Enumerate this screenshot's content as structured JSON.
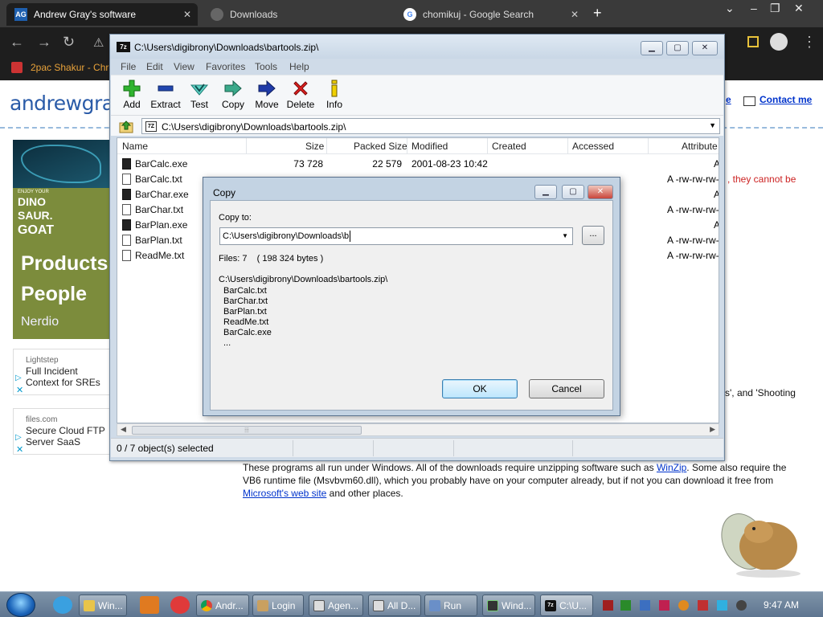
{
  "browser": {
    "tabs": [
      {
        "label": "Andrew Gray's software",
        "favicon": "AG"
      },
      {
        "label": "Downloads"
      },
      {
        "label": "chomikuj - Google Search"
      }
    ],
    "bookmark": "2pac Shakur - Chro"
  },
  "site": {
    "logo": "andrewgray",
    "e_link": "e",
    "contact": "Contact me",
    "ad1": {
      "small": "ENJOY YOUR",
      "line1": "DINO",
      "line2": "SAUR.",
      "line3": "GOAT",
      "products": "Products",
      "people": "People",
      "brand": "Nerdio"
    },
    "ad2": {
      "brand": "Lightstep",
      "title": "Full Incident Context for SREs"
    },
    "ad3": {
      "brand": "files.com",
      "title": "Secure Cloud FTP Server SaaS"
    },
    "red_text": ", they cannot be",
    "shooting_text": "s', and 'Shooting",
    "para_1": "These programs all run under Windows. All of the downloads require unzipping software such as ",
    "link_winzip": "WinZip",
    "para_2": ". Some also require the VB6 runtime file (Msvbvm60.dll), which you probably have on your computer already, but if not you can download it free from ",
    "link_ms": "Microsoft's web site",
    "para_3": " and other places."
  },
  "sevenzip": {
    "title": "C:\\Users\\digibrony\\Downloads\\bartools.zip\\",
    "menu": [
      "File",
      "Edit",
      "View",
      "Favorites",
      "Tools",
      "Help"
    ],
    "toolbar": [
      "Add",
      "Extract",
      "Test",
      "Copy",
      "Move",
      "Delete",
      "Info"
    ],
    "path": "C:\\Users\\digibrony\\Downloads\\bartools.zip\\",
    "columns": [
      "Name",
      "Size",
      "Packed Size",
      "Modified",
      "Created",
      "Accessed",
      "Attribute"
    ],
    "files": [
      {
        "name": "BarCalc.exe",
        "size": "73 728",
        "packed": "22 579",
        "modified": "2001-08-23 10:42",
        "attr": "A",
        "type": "exe"
      },
      {
        "name": "BarCalc.txt",
        "size": "",
        "packed": "",
        "modified": "",
        "attr": "A -rw-rw-rw-",
        "type": "txt"
      },
      {
        "name": "BarChar.exe",
        "size": "",
        "packed": "",
        "modified": "",
        "attr": "A",
        "type": "exe"
      },
      {
        "name": "BarChar.txt",
        "size": "",
        "packed": "",
        "modified": "",
        "attr": "A -rw-rw-rw-",
        "type": "txt"
      },
      {
        "name": "BarPlan.exe",
        "size": "",
        "packed": "",
        "modified": "",
        "attr": "A",
        "type": "exe"
      },
      {
        "name": "BarPlan.txt",
        "size": "",
        "packed": "",
        "modified": "",
        "attr": "A -rw-rw-rw-",
        "type": "txt"
      },
      {
        "name": "ReadMe.txt",
        "size": "",
        "packed": "",
        "modified": "",
        "attr": "A -rw-rw-rw-",
        "type": "txt"
      }
    ],
    "status": "0 / 7 object(s) selected"
  },
  "copy_dialog": {
    "title": "Copy",
    "copy_to_label": "Copy to:",
    "copy_to_value": "C:\\Users\\digibrony\\Downloads\\b",
    "browse": "...",
    "files_line": "Files: 7    ( 198 324 bytes )",
    "source_path": "C:\\Users\\digibrony\\Downloads\\bartools.zip\\",
    "files": [
      "BarCalc.txt",
      "BarChar.txt",
      "BarPlan.txt",
      "ReadMe.txt",
      "BarCalc.exe",
      "..."
    ],
    "ok": "OK",
    "cancel": "Cancel"
  },
  "taskbar": {
    "tasks": [
      "Win...",
      "Andr...",
      "Login",
      "Agen...",
      "All D...",
      "Run",
      "Wind...",
      "C:\\U..."
    ],
    "clock": "9:47 AM"
  },
  "colors": {
    "accent": "#2a5ba8",
    "link": "#0033cc",
    "title_bar": "#cfdbe8"
  }
}
